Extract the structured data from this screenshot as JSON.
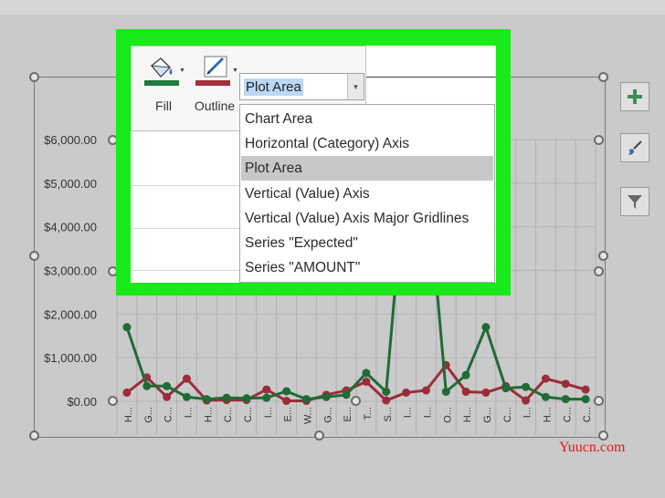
{
  "ribbon": {
    "fill_label": "Fill",
    "outline_label": "Outline",
    "fill_color": "#1e7d3b",
    "outline_color": "#a3303b"
  },
  "selector": {
    "current": "Plot Area",
    "options": [
      "Chart Area",
      "Horizontal (Category) Axis",
      "Plot Area",
      "Vertical (Value) Axis",
      "Vertical (Value) Axis Major Gridlines",
      "Series \"Expected\"",
      "Series \"AMOUNT\""
    ],
    "selected_index": 2
  },
  "side_buttons": [
    "plus-icon",
    "brush-icon",
    "funnel-icon"
  ],
  "chart_data": {
    "type": "line",
    "ylim": [
      0,
      6000
    ],
    "y_ticks": [
      "$0.00",
      "$1,000.00",
      "$2,000.00",
      "$3,000.00",
      "$4,000.00",
      "$5,000.00",
      "$6,000.00"
    ],
    "categories": [
      "H...",
      "G...",
      "C...",
      "I...",
      "H...",
      "C...",
      "C...",
      "I...",
      "E...",
      "W...",
      "G...",
      "E...",
      "T...",
      "S...",
      "I...",
      "I...",
      "O...",
      "H...",
      "G...",
      "C...",
      "I...",
      "H...",
      "C...",
      "C..."
    ],
    "series": [
      {
        "color": "#1f6b35",
        "values": [
          1700,
          350,
          350,
          100,
          50,
          80,
          70,
          80,
          230,
          50,
          100,
          150,
          650,
          220,
          5500,
          5400,
          220,
          600,
          1700,
          300,
          330,
          100,
          50,
          50
        ]
      },
      {
        "color": "#9b2d3a",
        "values": [
          200,
          550,
          100,
          520,
          20,
          30,
          30,
          270,
          10,
          10,
          150,
          250,
          450,
          20,
          200,
          250,
          830,
          220,
          200,
          350,
          20,
          520,
          400,
          270
        ]
      }
    ]
  },
  "watermark": "Yuucn.com"
}
